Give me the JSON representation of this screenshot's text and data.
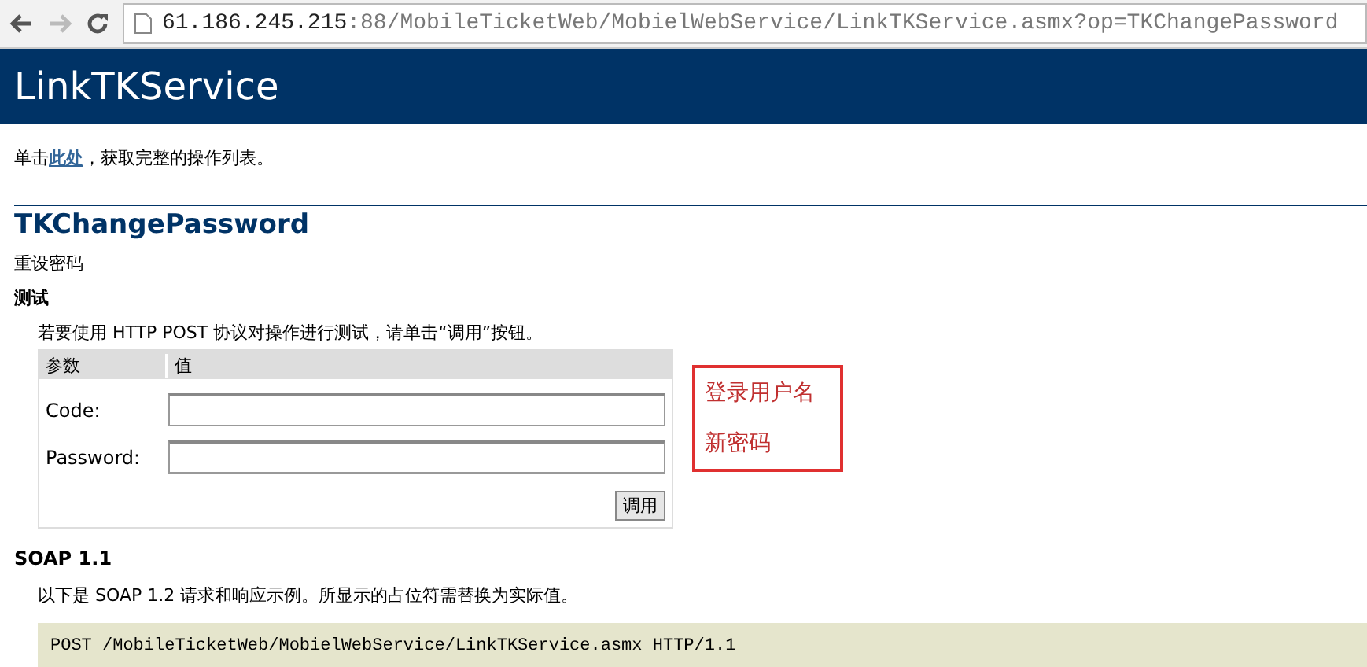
{
  "browser": {
    "url_host": "61.186.245.215",
    "url_rest": ":88/MobileTicketWeb/MobielWebService/LinkTKService.asmx?op=TKChangePassword"
  },
  "header": {
    "title": "LinkTKService"
  },
  "intro": {
    "before": "单击",
    "link": "此处",
    "after": "，获取完整的操作列表。"
  },
  "operation": {
    "title": "TKChangePassword",
    "description": "重设密码"
  },
  "test": {
    "heading": "测试",
    "instructions": "若要使用 HTTP POST 协议对操作进行测试，请单击“调用”按钮。",
    "columns": [
      "参数",
      "值"
    ],
    "params": [
      {
        "label": "Code:"
      },
      {
        "label": "Password:"
      }
    ],
    "invoke": "调用"
  },
  "annotation": {
    "notes": [
      "登录用户名",
      "新密码"
    ]
  },
  "soap": {
    "heading": "SOAP 1.1",
    "description": "以下是 SOAP 1.2 请求和响应示例。所显示的占位符需替换为实际值。",
    "code": "POST /MobileTicketWeb/MobielWebService/LinkTKService.asmx HTTP/1.1"
  }
}
